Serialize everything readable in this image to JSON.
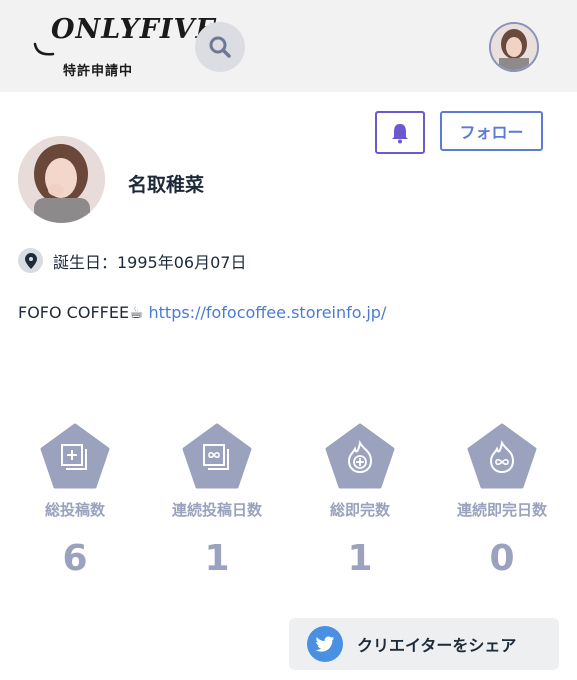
{
  "header": {
    "logo_text": "ONLYFIVE",
    "logo_sub": "特許申請中",
    "search_icon": "search-icon",
    "avatar_icon": "user-avatar"
  },
  "actions": {
    "bell_icon": "bell-icon",
    "follow_label": "フォロー"
  },
  "profile": {
    "name": "名取稚菜",
    "birthday_icon": "location-pin-icon",
    "birthday": "誕生日：1995年06月07日",
    "bio_text": "FOFO COFFEE☕ ",
    "bio_link": "https://fofocoffee.storeinfo.jp/"
  },
  "stats": [
    {
      "label": "総投稿数",
      "value": "6",
      "icon": "add-post-icon"
    },
    {
      "label": "連続投稿日数",
      "value": "1",
      "icon": "infinity-posts-icon"
    },
    {
      "label": "総即完数",
      "value": "1",
      "icon": "flame-plus-icon"
    },
    {
      "label": "連続即完日数",
      "value": "0",
      "icon": "flame-infinity-icon"
    }
  ],
  "share": {
    "icon": "twitter-icon",
    "label": "クリエイターをシェア"
  },
  "colors": {
    "accent": "#5b7bd5",
    "bell_border": "#6a5acd",
    "stat_gray": "#9aa2bd",
    "link": "#4a7bd6",
    "twitter": "#4a90e2"
  }
}
